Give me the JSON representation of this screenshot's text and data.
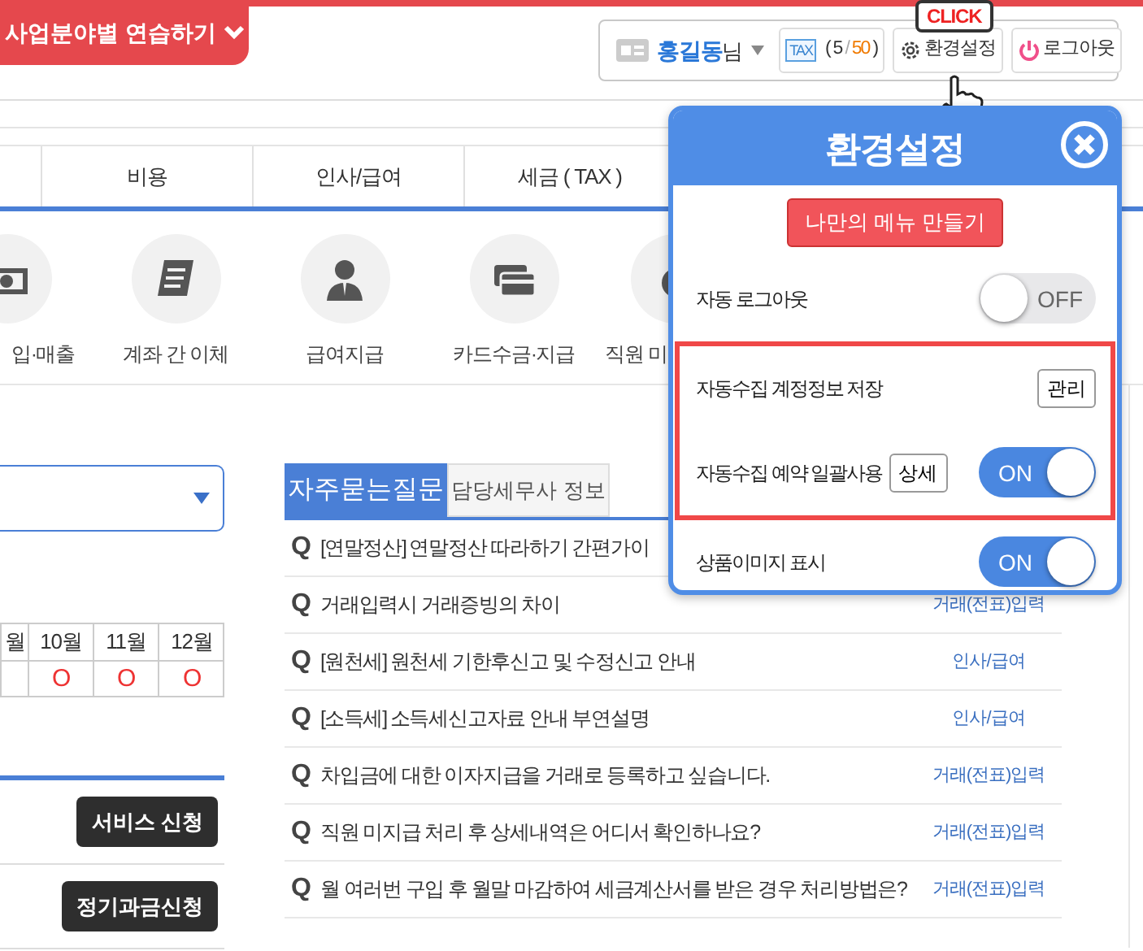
{
  "header": {
    "practice_button": "사업분야별 연습하기",
    "user": {
      "name": "홍길동",
      "suffix": "님"
    },
    "tax": {
      "label": "TAX",
      "open": "(",
      "used": "5",
      "sep": "/",
      "total": "50",
      "close": ")"
    },
    "settings_button": "환경설정",
    "logout_button": "로그아웃",
    "click_hint": "CLICK"
  },
  "menu_tabs": [
    {
      "label": "비용"
    },
    {
      "label": "인사/급여"
    },
    {
      "label": "세금 ( TAX )"
    }
  ],
  "shortcuts": [
    {
      "kind": "money",
      "label": "입·매출"
    },
    {
      "kind": "document",
      "label": "계좌 간 이체"
    },
    {
      "kind": "person",
      "label": "급여지급"
    },
    {
      "kind": "card",
      "label": "카드수금·지급"
    },
    {
      "kind": "moneybag",
      "label": "직원 미"
    }
  ],
  "month_table": {
    "columns": [
      "월",
      "10월",
      "11월",
      "12월"
    ],
    "values": [
      "O",
      "O",
      "O"
    ]
  },
  "services": [
    {
      "label": "서비스 신청"
    },
    {
      "label": "정기과금신청"
    }
  ],
  "faq": {
    "tabs": [
      {
        "label": "자주묻는질문",
        "selected": true
      },
      {
        "label": "담당세무사 정보",
        "selected": false
      }
    ],
    "items": [
      {
        "mark": "Q",
        "text": "[연말정산] 연말정산 따라하기 간편가이"
      },
      {
        "mark": "Q",
        "text": "거래입력시 거래증빙의 차이",
        "category": "거래(전표)입력"
      },
      {
        "mark": "Q",
        "text": "[원천세] 원천세 기한후신고 및 수정신고 안내",
        "category": "인사/급여"
      },
      {
        "mark": "Q",
        "text": "[소득세] 소득세신고자료 안내 부연설명",
        "category": "인사/급여"
      },
      {
        "mark": "Q",
        "text": "차입금에 대한 이자지급을 거래로 등록하고 싶습니다.",
        "category": "거래(전표)입력"
      },
      {
        "mark": "Q",
        "text": "직원 미지급 처리 후 상세내역은 어디서 확인하나요?",
        "category": "거래(전표)입력"
      },
      {
        "mark": "Q",
        "text": "월 여러번 구입 후 월말 마감하여 세금계산서를 받은 경우 처리방법은?",
        "category": "거래(전표)입력"
      }
    ]
  },
  "settings_popup": {
    "title": "환경설정",
    "custom_menu_button": "나만의 메뉴 만들기",
    "groups": [
      {
        "highlighted": false,
        "rows": [
          {
            "kind": "toggle",
            "label": "자동 로그아웃",
            "on": false,
            "state_text": "OFF"
          }
        ]
      },
      {
        "highlighted": true,
        "rows": [
          {
            "kind": "button",
            "label": "자동수집 계정정보 저장",
            "button": "관리"
          },
          {
            "kind": "button-toggle",
            "label": "자동수집 예약 일괄사용",
            "button": "상세",
            "on": true,
            "state_text": "ON"
          }
        ]
      },
      {
        "highlighted": false,
        "rows": [
          {
            "kind": "toggle",
            "label": "상품이미지 표시",
            "on": true,
            "state_text": "ON"
          }
        ]
      }
    ]
  }
}
